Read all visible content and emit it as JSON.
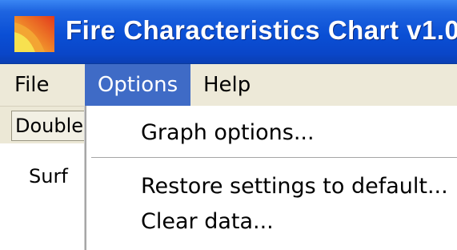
{
  "window": {
    "title": "Fire Characteristics Chart v1.0",
    "icon": "app-flame-icon"
  },
  "menubar": {
    "items": [
      {
        "label": "File"
      },
      {
        "label": "Options",
        "state": "open"
      },
      {
        "label": "Help"
      }
    ]
  },
  "toolbar": {
    "button_label": "Double"
  },
  "content": {
    "label": "Surf"
  },
  "options_menu": {
    "items": [
      {
        "label": "Graph options..."
      },
      {
        "separator": true
      },
      {
        "label": "Restore settings to default..."
      },
      {
        "label": "Clear data..."
      }
    ]
  },
  "colors": {
    "titlebar": "#0a4fd5",
    "menu_highlight": "#3f6bc6",
    "menubar_bg": "#ede9d8"
  }
}
